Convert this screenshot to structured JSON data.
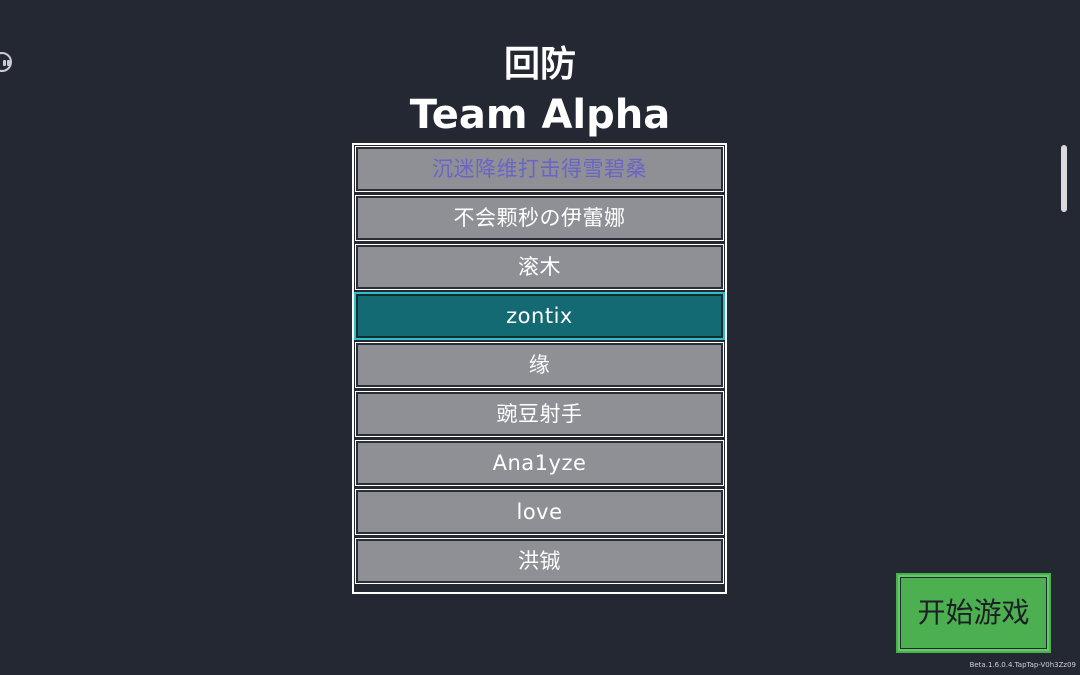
{
  "header": {
    "mode_title": "回防",
    "team_title": "Team Alpha"
  },
  "players": [
    {
      "name": "沉迷降维打击得雪碧桑",
      "role": "host"
    },
    {
      "name": "不会颗秒の伊蕾娜",
      "role": "normal"
    },
    {
      "name": "滚木",
      "role": "normal"
    },
    {
      "name": "zontix",
      "role": "selected"
    },
    {
      "name": "缘",
      "role": "normal"
    },
    {
      "name": "豌豆射手",
      "role": "normal"
    },
    {
      "name": "Ana1yze",
      "role": "normal"
    },
    {
      "name": "love",
      "role": "normal"
    },
    {
      "name": "洪铖",
      "role": "normal"
    }
  ],
  "start_button": {
    "label": "开始游戏"
  },
  "footer": {
    "version": "Beta.1.6.0.4.TapTap-V0h3Zz09"
  },
  "colors": {
    "background": "#232833",
    "slot": "#8e9096",
    "selected_slot": "#136a72",
    "host_text": "#6b64c6",
    "start_button": "#4caf50"
  },
  "icons": {
    "menu": "robot-face-icon"
  }
}
